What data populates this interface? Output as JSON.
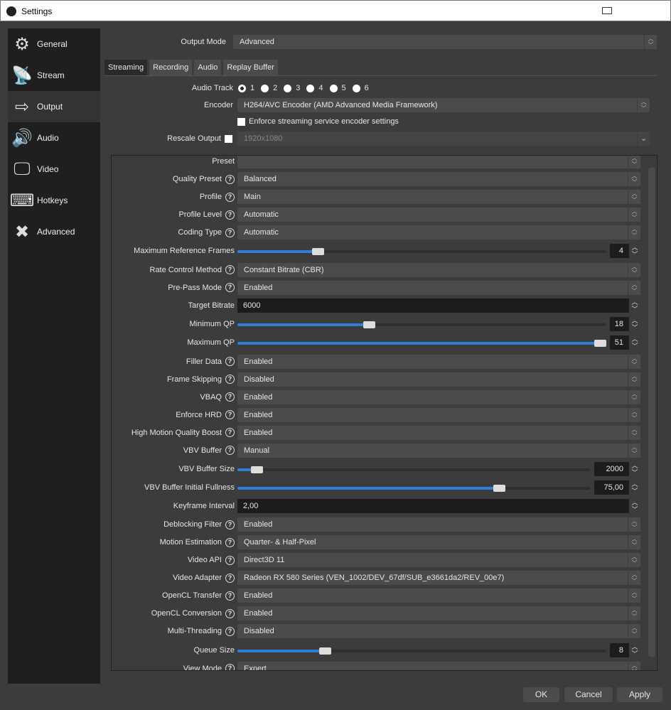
{
  "window": {
    "title": "Settings"
  },
  "sidebar": {
    "items": [
      {
        "label": "General",
        "icon": "gear-icon",
        "glyph": "⚙"
      },
      {
        "label": "Stream",
        "icon": "antenna-icon",
        "glyph": "📡"
      },
      {
        "label": "Output",
        "icon": "monitor-arrow-icon",
        "glyph": "⇨",
        "selected": true
      },
      {
        "label": "Audio",
        "icon": "speaker-icon",
        "glyph": "🔊"
      },
      {
        "label": "Video",
        "icon": "monitor-icon",
        "glyph": "🖵"
      },
      {
        "label": "Hotkeys",
        "icon": "keyboard-icon",
        "glyph": "⌨"
      },
      {
        "label": "Advanced",
        "icon": "tools-icon",
        "glyph": "✖"
      }
    ]
  },
  "output_mode": {
    "label": "Output Mode",
    "value": "Advanced"
  },
  "tabs": [
    {
      "label": "Streaming",
      "selected": true
    },
    {
      "label": "Recording"
    },
    {
      "label": "Audio"
    },
    {
      "label": "Replay Buffer"
    }
  ],
  "audio_track": {
    "label": "Audio Track",
    "options": [
      "1",
      "2",
      "3",
      "4",
      "5",
      "6"
    ],
    "selected": "1"
  },
  "encoder": {
    "label": "Encoder",
    "value": "H264/AVC Encoder (AMD Advanced Media Framework)"
  },
  "enforce": {
    "label": "Enforce streaming service encoder settings",
    "checked": false
  },
  "rescale": {
    "label": "Rescale Output",
    "checked": false,
    "value": "1920x1080"
  },
  "settings": [
    {
      "label": "Preset",
      "type": "combo",
      "value": ""
    },
    {
      "label": "Quality Preset",
      "help": true,
      "type": "combo",
      "value": "Balanced"
    },
    {
      "label": "Profile",
      "help": true,
      "type": "combo",
      "value": "Main"
    },
    {
      "label": "Profile Level",
      "help": true,
      "type": "combo",
      "value": "Automatic"
    },
    {
      "label": "Coding Type",
      "help": true,
      "type": "combo",
      "value": "Automatic"
    },
    {
      "label": "Maximum Reference Frames",
      "type": "slider",
      "value": "4",
      "fraction": 0.21
    },
    {
      "label": "Rate Control Method",
      "help": true,
      "type": "combo",
      "value": "Constant Bitrate (CBR)"
    },
    {
      "label": "Pre-Pass Mode",
      "help": true,
      "type": "combo",
      "value": "Enabled"
    },
    {
      "label": "Target Bitrate",
      "type": "input",
      "value": "6000"
    },
    {
      "label": "Minimum QP",
      "type": "slider",
      "value": "18",
      "fraction": 0.353
    },
    {
      "label": "Maximum QP",
      "type": "slider",
      "value": "51",
      "fraction": 1.0
    },
    {
      "label": "Filler Data",
      "help": true,
      "type": "combo",
      "value": "Enabled"
    },
    {
      "label": "Frame Skipping",
      "help": true,
      "type": "combo",
      "value": "Disabled"
    },
    {
      "label": "VBAQ",
      "help": true,
      "type": "combo",
      "value": "Enabled"
    },
    {
      "label": "Enforce HRD",
      "help": true,
      "type": "combo",
      "value": "Enabled"
    },
    {
      "label": "High Motion Quality Boost",
      "help": true,
      "type": "combo",
      "value": "Enabled"
    },
    {
      "label": "VBV Buffer",
      "help": true,
      "type": "combo",
      "value": "Manual"
    },
    {
      "label": "VBV Buffer Size",
      "type": "slider",
      "value": "2000",
      "fraction": 0.04,
      "wide": true
    },
    {
      "label": "VBV Buffer Initial Fullness",
      "type": "slider",
      "value": "75,00",
      "fraction": 0.75,
      "wide": true
    },
    {
      "label": "Keyframe Interval",
      "type": "input",
      "value": "2,00"
    },
    {
      "label": "Deblocking Filter",
      "help": true,
      "type": "combo",
      "value": "Enabled"
    },
    {
      "label": "Motion Estimation",
      "help": true,
      "type": "combo",
      "value": "Quarter- & Half-Pixel"
    },
    {
      "label": "Video API",
      "help": true,
      "type": "combo",
      "value": "Direct3D 11"
    },
    {
      "label": "Video Adapter",
      "help": true,
      "type": "combo",
      "value": "Radeon RX 580 Series (VEN_1002/DEV_67df/SUB_e3661da2/REV_00e7)"
    },
    {
      "label": "OpenCL Transfer",
      "help": true,
      "type": "combo",
      "value": "Enabled"
    },
    {
      "label": "OpenCL Conversion",
      "help": true,
      "type": "combo",
      "value": "Enabled"
    },
    {
      "label": "Multi-Threading",
      "help": true,
      "type": "combo",
      "value": "Disabled"
    },
    {
      "label": "Queue Size",
      "type": "slider",
      "value": "8",
      "fraction": 0.23
    },
    {
      "label": "View Mode",
      "help": true,
      "type": "combo",
      "value": "Expert"
    }
  ],
  "buttons": {
    "ok": "OK",
    "cancel": "Cancel",
    "apply": "Apply"
  },
  "colors": {
    "accent": "#2f7fd8"
  }
}
